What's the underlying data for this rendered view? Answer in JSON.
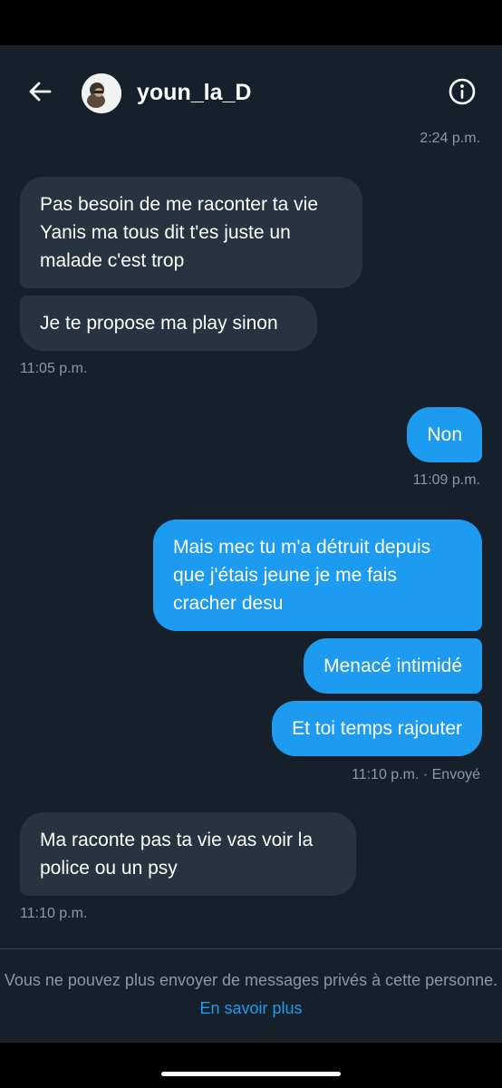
{
  "header": {
    "username": "youn_la_D"
  },
  "messages": [
    {
      "type": "timestamp",
      "side": "right",
      "text": "2:24 p.m."
    },
    {
      "type": "received",
      "text": "Pas besoin de me raconter ta vie Yanis ma tous dit t'es juste un malade c'est trop"
    },
    {
      "type": "received",
      "text": "Je te propose ma play sinon"
    },
    {
      "type": "timestamp",
      "side": "left",
      "text": "11:05 p.m."
    },
    {
      "type": "sent",
      "text": "Non"
    },
    {
      "type": "timestamp",
      "side": "right",
      "text": "11:09 p.m."
    },
    {
      "type": "sent",
      "text": "Mais mec tu m'a détruit depuis que j'étais jeune je me fais cracher desu"
    },
    {
      "type": "sent",
      "text": "Menacé intimidé"
    },
    {
      "type": "sent",
      "text": "Et toi temps rajouter"
    },
    {
      "type": "timestamp",
      "side": "right",
      "text": "11:10 p.m. · Envoyé"
    },
    {
      "type": "received",
      "text": "Ma raconte pas ta vie vas voir la police ou un psy"
    },
    {
      "type": "timestamp",
      "side": "left",
      "text": "11:10 p.m."
    }
  ],
  "footer": {
    "notice": "Vous ne pouvez plus envoyer de messages privés à cette personne.",
    "link": "En savoir plus"
  },
  "colors": {
    "background": "#15202b",
    "received_bubble": "#273340",
    "sent_bubble": "#1d9bf0",
    "muted_text": "#8b98a5",
    "link": "#1d9bf0"
  },
  "icons": [
    "back-arrow-icon",
    "info-icon"
  ]
}
